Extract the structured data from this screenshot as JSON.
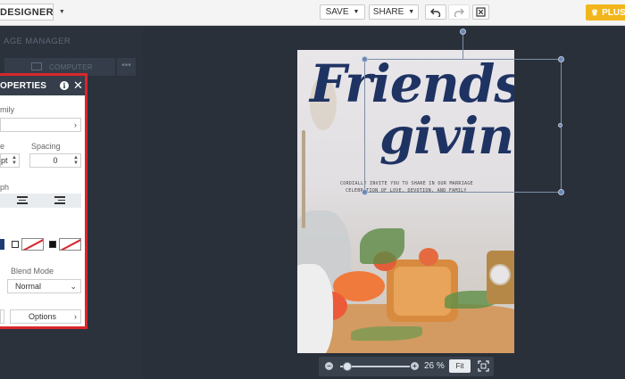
{
  "topbar": {
    "mode_label": "DESIGNER",
    "save_label": "SAVE",
    "share_label": "SHARE",
    "plus_label": "PLUS",
    "icons": [
      "undo-icon",
      "redo-icon",
      "close-square-icon",
      "crown-icon"
    ]
  },
  "image_manager": {
    "title": "AGE MANAGER",
    "tab_label": "COMPUTER",
    "more_label": "•••"
  },
  "properties": {
    "title": "OPERTIES",
    "family_label": "mily",
    "size_label": "e",
    "size_value": "pt",
    "spacing_label": "Spacing",
    "spacing_value": "0",
    "paragraph_label": "ph",
    "blend_label": "Blend Mode",
    "blend_value": "Normal",
    "options_label": "Options"
  },
  "poster": {
    "headline_1": "Friends",
    "headline_2": "giving",
    "invite_line_1": "CORDIALLY INVITE YOU TO SHARE IN OUR MARRIAGE",
    "invite_line_2": "CELEBRATION OF LOVE, DEVOTION, AND FAMILY",
    "headline_color": "#1f3363"
  },
  "zoom": {
    "percent": "26 %",
    "fit_label": "Fit",
    "level": 0.26
  },
  "colors": {
    "highlight": "#d9262c",
    "accent": "#f2b61c",
    "panel_dark": "#2b323c"
  }
}
